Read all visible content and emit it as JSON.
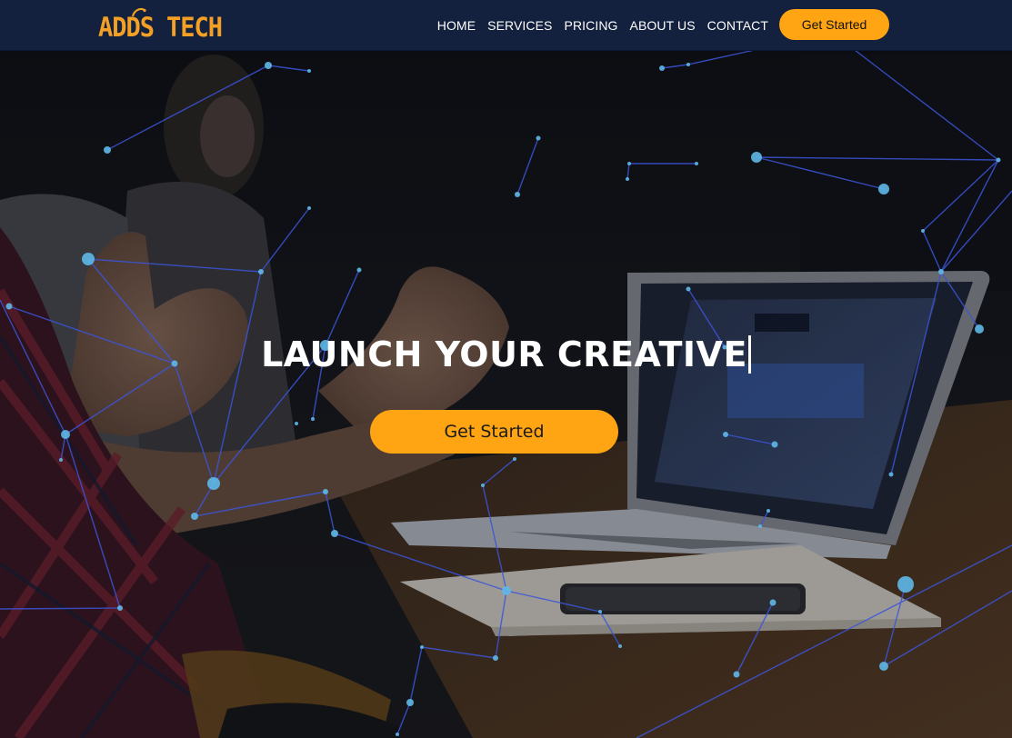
{
  "brand": {
    "logo_text_left": "ADDS",
    "logo_text_right": "TECH",
    "logo_color": "#f4a024"
  },
  "nav": {
    "items": [
      {
        "label": "HOME"
      },
      {
        "label": "SERVICES"
      },
      {
        "label": "PRICING"
      },
      {
        "label": "ABOUT US"
      },
      {
        "label": "CONTACT"
      }
    ],
    "cta_label": "Get Started"
  },
  "hero": {
    "headline": "LAUNCH YOUR CREATIVE",
    "cta_label": "Get Started",
    "background": "photo-of-meeting-with-laptop-and-phone"
  },
  "colors": {
    "navbar_bg": "#13213f",
    "accent": "#ffa412",
    "network_line": "#3b55d9",
    "network_node": "#5fb8e8"
  }
}
